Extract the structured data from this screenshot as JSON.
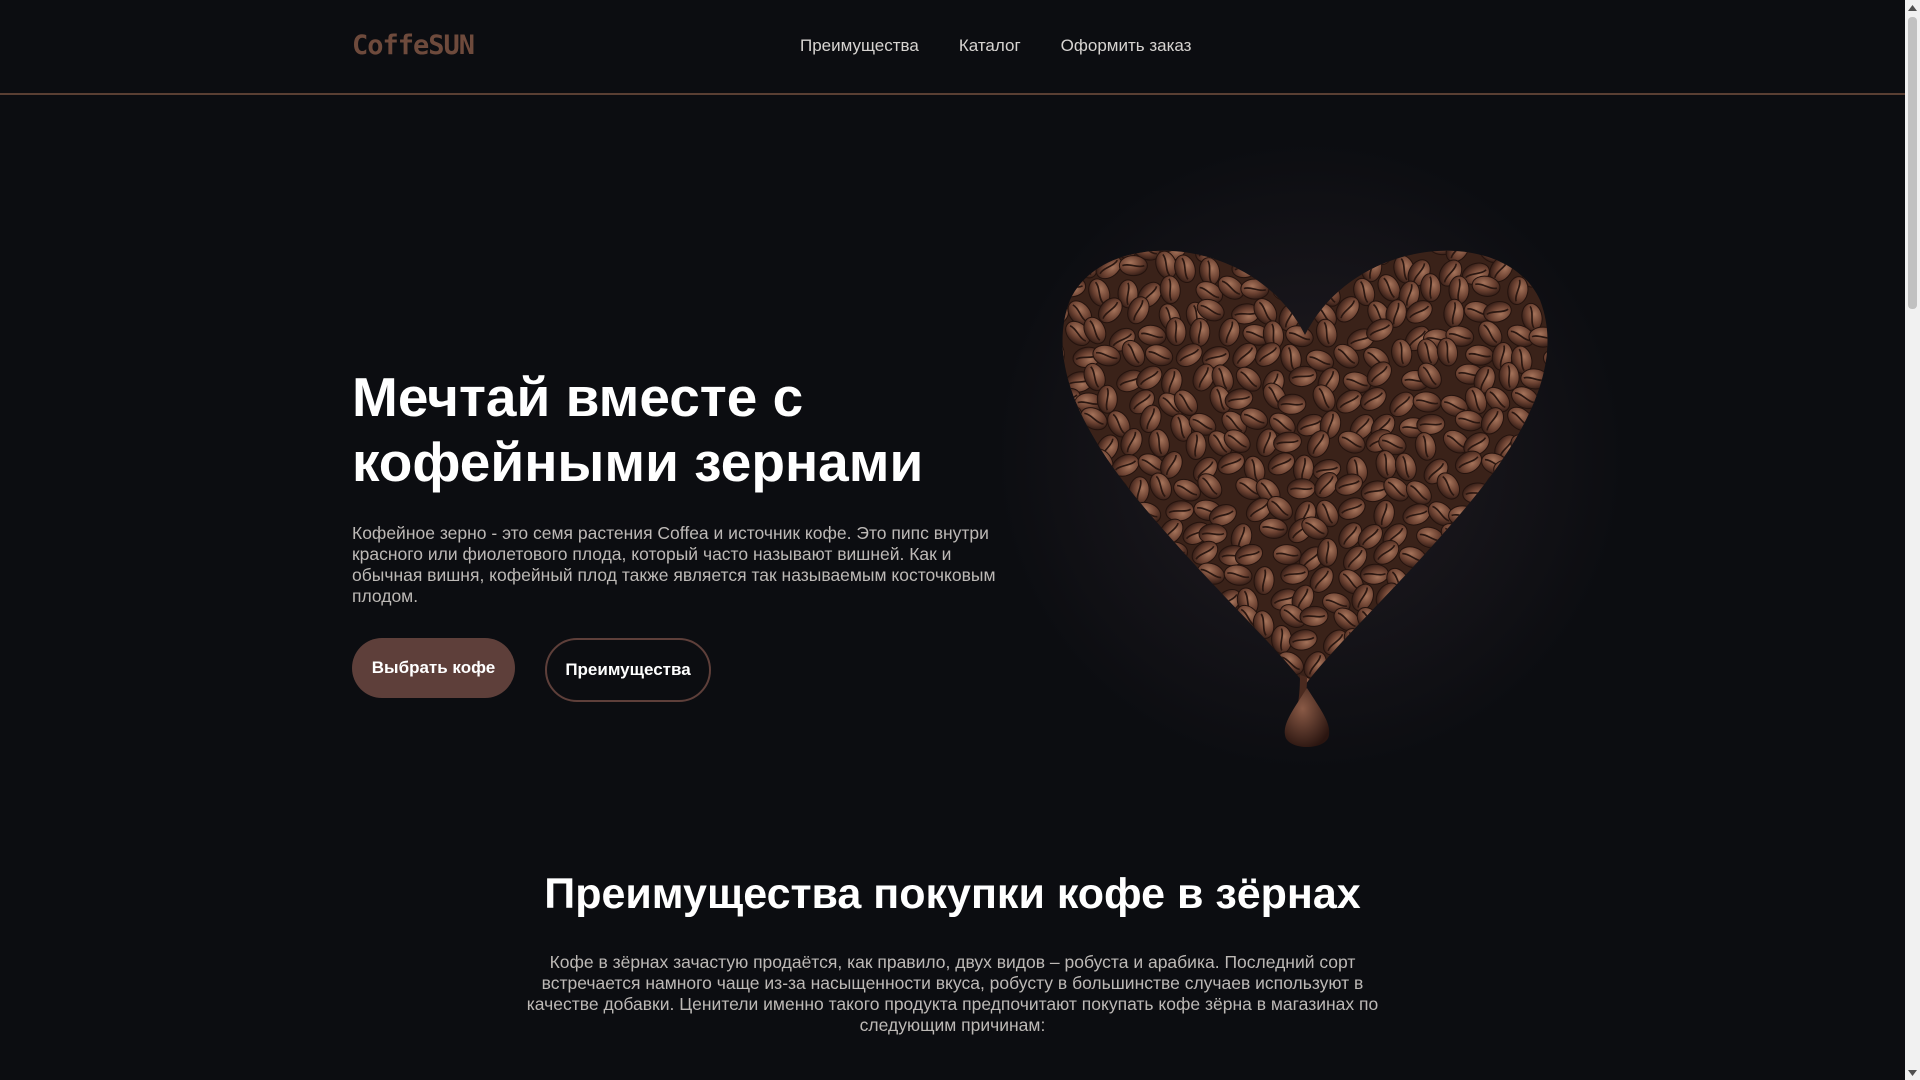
{
  "header": {
    "logo": "CoffeSUN",
    "nav": [
      "Преимущества",
      "Каталог",
      "Оформить заказ"
    ]
  },
  "hero": {
    "title": "Мечтай вместе с кофейными зернами",
    "text": "Кофейное зерно - это семя растения Coffea и источник кофе. Это пипс внутри красного или фиолетового плода, который часто называют вишней. Как и обычная вишня, кофейный плод также является так называемым косточковым плодом.",
    "btn_primary": "Выбрать кофе",
    "btn_secondary": "Преимущества",
    "image": "coffee-beans-heart"
  },
  "section": {
    "title": "Преимущества покупки кофе в зёрнах",
    "text": "Кофе в зёрнах зачастую продаётся, как правило, двух видов – робуста и арабика. Последний сорт встречается намного чаще из-за насыщенности вкуса, робусту в большинстве случаев используют в качестве добавки. Ценители именно такого продукта предпочитают покупать кофе зёрна в магазинах по следующим причинам:"
  },
  "colors": {
    "background": "#0b0c10",
    "accent": "#5e3f3a",
    "logo": "#6e4a3c"
  }
}
